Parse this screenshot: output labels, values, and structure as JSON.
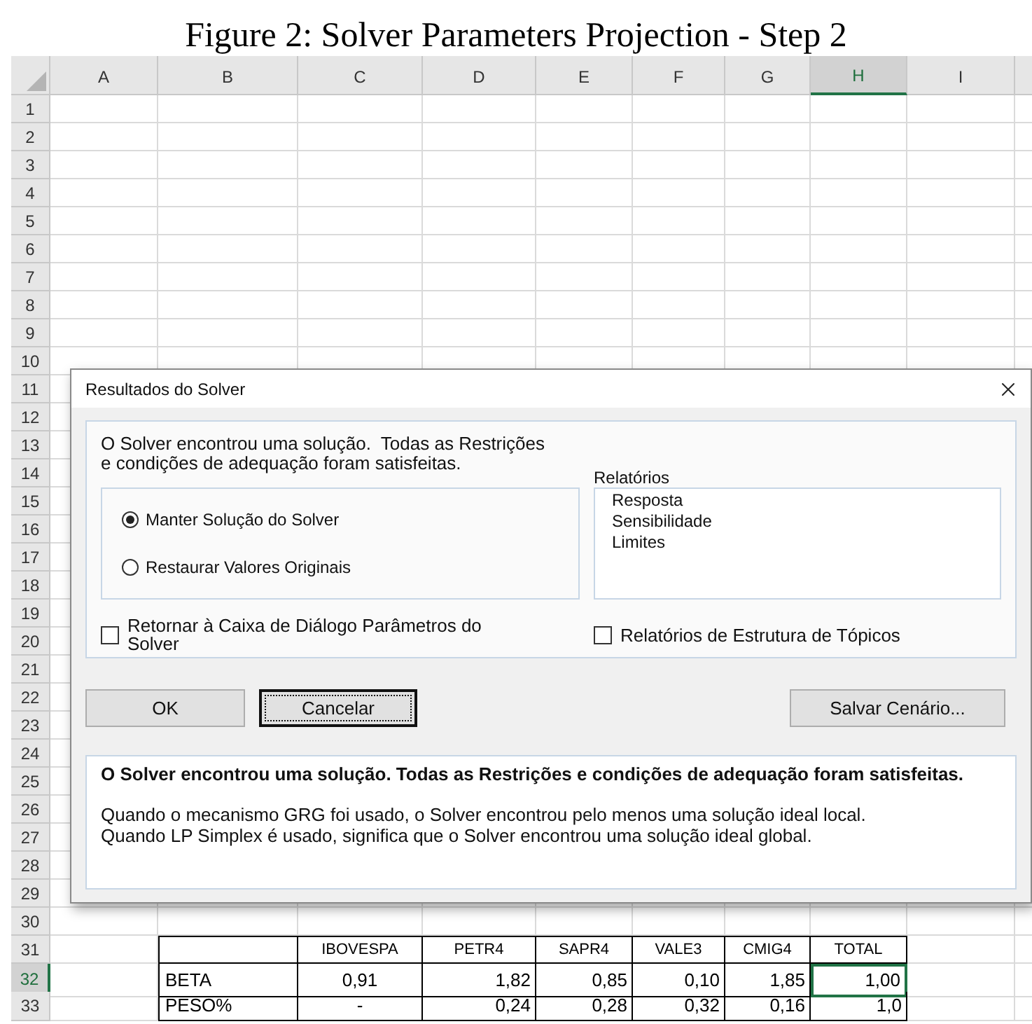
{
  "caption": "Figure 2: Solver Parameters Projection - Step 2",
  "sheet": {
    "columns": [
      {
        "label": "A",
        "selected": false
      },
      {
        "label": "B",
        "selected": false
      },
      {
        "label": "C",
        "selected": false
      },
      {
        "label": "D",
        "selected": false
      },
      {
        "label": "E",
        "selected": false
      },
      {
        "label": "F",
        "selected": false
      },
      {
        "label": "G",
        "selected": false
      },
      {
        "label": "H",
        "selected": true
      },
      {
        "label": "I",
        "selected": false
      }
    ],
    "rows": [
      {
        "label": "1",
        "selected": false
      },
      {
        "label": "2",
        "selected": false
      },
      {
        "label": "3",
        "selected": false
      },
      {
        "label": "4",
        "selected": false
      },
      {
        "label": "5",
        "selected": false
      },
      {
        "label": "6",
        "selected": false
      },
      {
        "label": "7",
        "selected": false
      },
      {
        "label": "8",
        "selected": false
      },
      {
        "label": "9",
        "selected": false
      },
      {
        "label": "10",
        "selected": false
      },
      {
        "label": "11",
        "selected": false
      },
      {
        "label": "12",
        "selected": false
      },
      {
        "label": "13",
        "selected": false
      },
      {
        "label": "14",
        "selected": false
      },
      {
        "label": "15",
        "selected": false
      },
      {
        "label": "16",
        "selected": false
      },
      {
        "label": "17",
        "selected": false
      },
      {
        "label": "18",
        "selected": false
      },
      {
        "label": "19",
        "selected": false
      },
      {
        "label": "20",
        "selected": false
      },
      {
        "label": "21",
        "selected": false
      },
      {
        "label": "22",
        "selected": false
      },
      {
        "label": "23",
        "selected": false
      },
      {
        "label": "24",
        "selected": false
      },
      {
        "label": "25",
        "selected": false
      },
      {
        "label": "26",
        "selected": false
      },
      {
        "label": "27",
        "selected": false
      },
      {
        "label": "28",
        "selected": false
      },
      {
        "label": "29",
        "selected": false
      },
      {
        "label": "30",
        "selected": false
      },
      {
        "label": "31",
        "selected": false
      },
      {
        "label": "32",
        "selected": true
      },
      {
        "label": "33",
        "selected": false
      }
    ],
    "table": {
      "header": [
        "IBOVESPA",
        "PETR4",
        "SAPR4",
        "VALE3",
        "CMIG4",
        "TOTAL"
      ],
      "rows": [
        {
          "label": "BETA",
          "values": [
            {
              "text": "0,91",
              "selected": false
            },
            {
              "text": "1,82",
              "selected": false
            },
            {
              "text": "0,85",
              "selected": false
            },
            {
              "text": "0,10",
              "selected": false
            },
            {
              "text": "1,85",
              "selected": false
            },
            {
              "text": "1,00",
              "selected": true
            }
          ]
        },
        {
          "label": "PESO%",
          "values": [
            {
              "text": "-",
              "selected": false
            },
            {
              "text": "0,24",
              "selected": false
            },
            {
              "text": "0,28",
              "selected": false
            },
            {
              "text": "0,32",
              "selected": false
            },
            {
              "text": "0,16",
              "selected": false
            },
            {
              "text": "1,0",
              "selected": false
            }
          ]
        }
      ]
    }
  },
  "dialog": {
    "title": "Resultados do Solver",
    "message": [
      "O Solver encontrou uma solução.  Todas as Restrições",
      "e condições de adequação foram satisfeitas."
    ],
    "options": [
      {
        "label": "Manter Solução do Solver",
        "selected": true
      },
      {
        "label": "Restaurar Valores Originais",
        "selected": false
      }
    ],
    "reports": {
      "label": "Relatórios",
      "items": [
        "Resposta",
        "Sensibilidade",
        "Limites"
      ]
    },
    "checkboxes": [
      {
        "label": "Retornar à Caixa de Diálogo Parâmetros do Solver",
        "checked": false
      },
      {
        "label": "Relatórios de Estrutura de Tópicos",
        "checked": false
      }
    ],
    "buttons": [
      {
        "label": "OK",
        "focused": false
      },
      {
        "label": "Cancelar",
        "focused": true
      },
      {
        "label": "Salvar Cenário...",
        "focused": false
      }
    ],
    "result": {
      "heading": "O Solver encontrou uma solução.  Todas as Restrições e condições de adequação foram satisfeitas.",
      "lines": [
        "Quando o mecanismo GRG foi usado, o Solver encontrou pelo menos uma solução ideal local.",
        "Quando LP Simplex é usado, significa que o Solver encontrou uma solução ideal global."
      ]
    }
  }
}
